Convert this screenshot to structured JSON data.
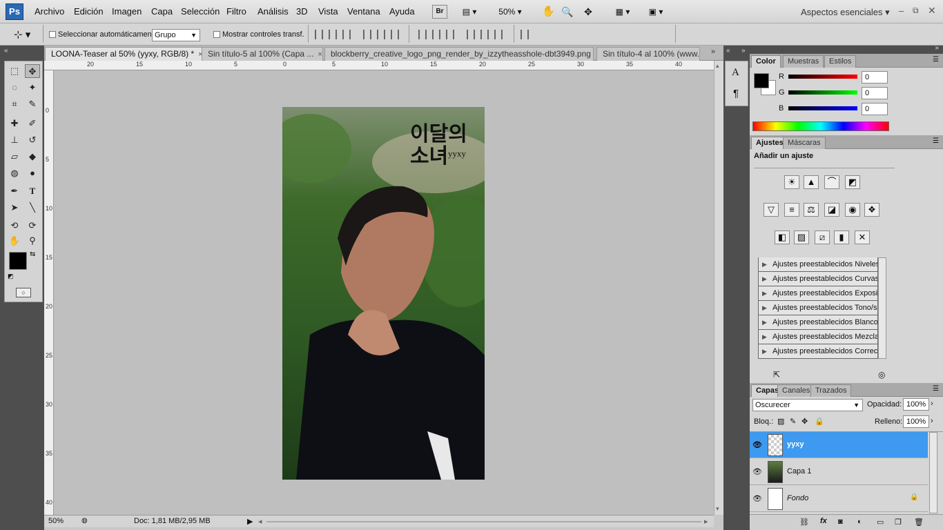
{
  "menubar": {
    "logo": "Ps",
    "items": [
      "Archivo",
      "Edición",
      "Imagen",
      "Capa",
      "Selección",
      "Filtro",
      "Análisis",
      "3D",
      "Vista",
      "Ventana",
      "Ayuda"
    ],
    "br": "Br",
    "zoom": "50%",
    "workspace": "Aspectos esenciales"
  },
  "options": {
    "auto_select_label": "Seleccionar automáticamente:",
    "auto_select_value": "Grupo",
    "show_controls_label": "Mostrar controles transf."
  },
  "tabs": [
    {
      "label": "LOONA-Teaser al 50% (yyxy, RGB/8) *",
      "close": "×"
    },
    {
      "label": "Sin título-5 al 100% (Capa ...",
      "close": "×"
    },
    {
      "label": "blockberry_creative_logo_png_render_by_izzytheasshole-dbt3949.png",
      "close": "×"
    },
    {
      "label": "Sin título-4 al 100% (www...",
      "close": ""
    }
  ],
  "ruler_h": [
    "20",
    "15",
    "10",
    "5",
    "0",
    "5",
    "10",
    "15",
    "20",
    "25",
    "30",
    "35",
    "40"
  ],
  "ruler_v": [
    "0",
    "5",
    "10",
    "15",
    "20",
    "25",
    "30",
    "35",
    "40"
  ],
  "image_text": {
    "korean_line1": "이달의",
    "korean_line2": "소녀",
    "overlay": "yyxy"
  },
  "status": {
    "zoom": "50%",
    "doc": "Doc: 1,81 MB/2,95 MB"
  },
  "color_panel": {
    "tabs": [
      "Color",
      "Muestras",
      "Estilos"
    ],
    "channels": [
      {
        "label": "R",
        "value": "0"
      },
      {
        "label": "G",
        "value": "0"
      },
      {
        "label": "B",
        "value": "0"
      }
    ]
  },
  "adjust_panel": {
    "tabs": [
      "Ajustes",
      "Máscaras"
    ],
    "heading": "Añadir un ajuste",
    "presets": [
      "Ajustes preestablecidos Niveles",
      "Ajustes preestablecidos Curvas",
      "Ajustes preestablecidos Exposici...",
      "Ajustes preestablecidos Tono/sa...",
      "Ajustes preestablecidos Blanco ...",
      "Ajustes preestablecidos Mezclad...",
      "Ajustes preestablecidos Correcci..."
    ]
  },
  "layers_panel": {
    "tabs": [
      "Capas",
      "Canales",
      "Trazados"
    ],
    "blend_mode": "Oscurecer",
    "opacity_label": "Opacidad:",
    "opacity": "100%",
    "lock_label": "Bloq.:",
    "fill_label": "Relleno:",
    "fill": "100%",
    "layers": [
      {
        "name": "yyxy",
        "selected": true
      },
      {
        "name": "Capa 1",
        "selected": false
      },
      {
        "name": "Fondo",
        "selected": false
      }
    ]
  },
  "colors": {
    "accent": "#3d9af0",
    "panel": "#d6d6d6",
    "dark": "#4e4e4e"
  }
}
